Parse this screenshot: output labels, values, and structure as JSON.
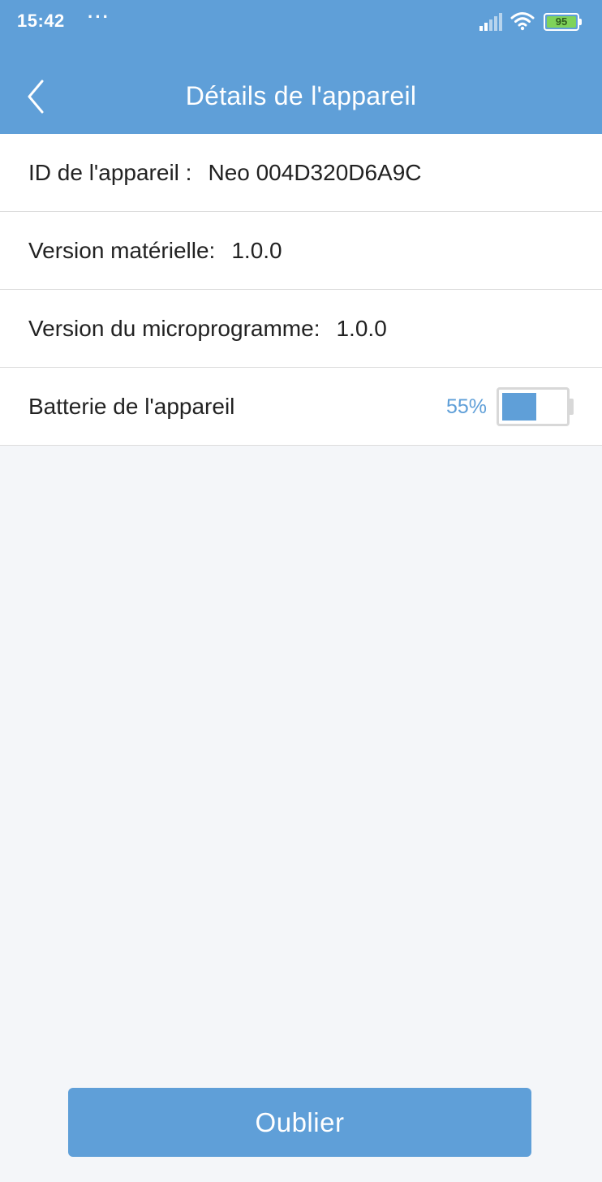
{
  "status_bar": {
    "time": "15:42",
    "notification_dots": "···",
    "battery_level": "95",
    "battery_color": "#7fd35a"
  },
  "app_bar": {
    "title": "Détails de l'appareil",
    "back_icon": "chevron-left-icon",
    "background_color": "#5f9fd8"
  },
  "details": {
    "device_id": {
      "label": "ID de l'appareil :",
      "value": "Neo 004D320D6A9C"
    },
    "hardware_version": {
      "label": "Version matérielle:",
      "value": "1.0.0"
    },
    "firmware_version": {
      "label": "Version du microprogramme:",
      "value": "1.0.0"
    },
    "battery": {
      "label": "Batterie de l'appareil",
      "percent_text": "55%",
      "level_percent": 55
    }
  },
  "actions": {
    "forget_label": "Oublier"
  }
}
